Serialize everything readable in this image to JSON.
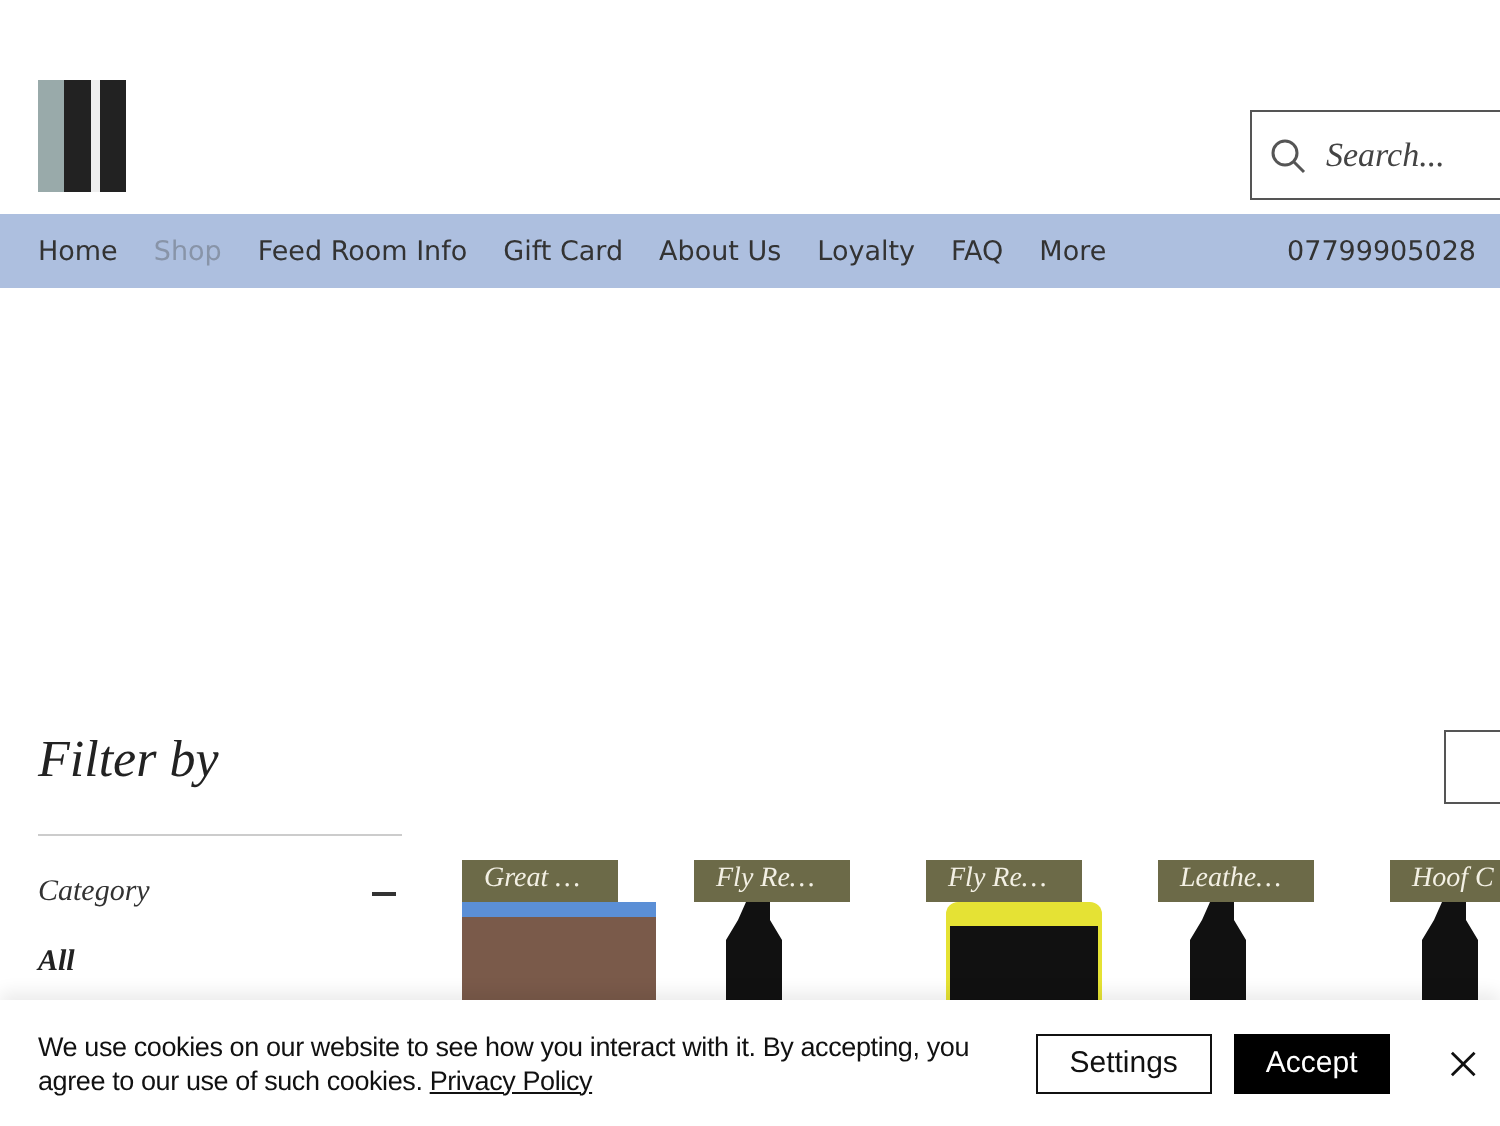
{
  "header": {
    "search": {
      "placeholder": "Search..."
    }
  },
  "nav": {
    "items": [
      {
        "label": "Home",
        "selected": false
      },
      {
        "label": "Shop",
        "selected": true
      },
      {
        "label": "Feed Room Info",
        "selected": false
      },
      {
        "label": "Gift Card",
        "selected": false
      },
      {
        "label": "About Us",
        "selected": false
      },
      {
        "label": "Loyalty",
        "selected": false
      },
      {
        "label": "FAQ",
        "selected": false
      },
      {
        "label": "More",
        "selected": false
      }
    ],
    "phone": "07799905028"
  },
  "filter": {
    "title": "Filter by",
    "category": "Category",
    "expanded": true,
    "options": [
      {
        "label": "All",
        "selected": true
      }
    ]
  },
  "products": [
    {
      "name": "Great …",
      "kind": "photo"
    },
    {
      "name": "Fly Re…",
      "kind": "bottle"
    },
    {
      "name": "Fly Re…",
      "kind": "tub"
    },
    {
      "name": "Leathe…",
      "kind": "bottle"
    },
    {
      "name": "Hoof C",
      "kind": "bottle"
    }
  ],
  "cookie_banner": {
    "text": "We use cookies on our website to see how you interact with it. By accepting, you agree to our use of such cookies.",
    "link": "Privacy Policy",
    "buttons": [
      {
        "label": "Settings",
        "kind": "outline"
      },
      {
        "label": "Accept",
        "kind": "solid"
      }
    ]
  }
}
